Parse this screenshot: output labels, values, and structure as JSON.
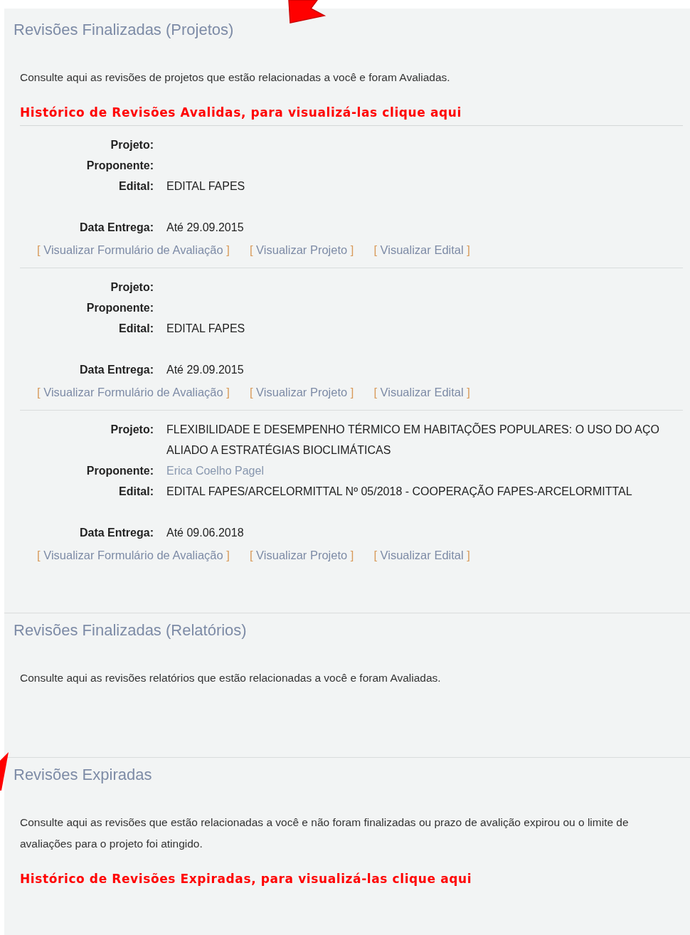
{
  "sections": [
    {
      "title": "Revisões Finalizadas (Projetos)",
      "description": "Consulte aqui as revisões de projetos que estão relacionadas a você e foram Avaliadas.",
      "history_link": "Histórico de Revisões Avalidas, para visualizá-las clique aqui",
      "records": [
        {
          "fields": [
            {
              "label": "Projeto:"
            },
            {
              "label": "Proponente:"
            },
            {
              "label": "Edital:",
              "value": "EDITAL FAPES"
            },
            {
              "label": "Data Entrega:",
              "value": "Até 29.09.2015"
            }
          ],
          "links": [
            {
              "open": "[",
              "label": "Visualizar Formulário de Avaliação",
              "close": "]"
            },
            {
              "open": "[",
              "label": "Visualizar Projeto",
              "close": "]"
            },
            {
              "open": "[",
              "label": "Visualizar Edital",
              "close": "]"
            }
          ]
        },
        {
          "fields": [
            {
              "label": "Projeto:"
            },
            {
              "label": "Proponente:"
            },
            {
              "label": "Edital:",
              "value": "EDITAL FAPES"
            },
            {
              "label": "Data Entrega:",
              "value": "Até 29.09.2015"
            }
          ],
          "links": [
            {
              "open": "[",
              "label": "Visualizar Formulário de Avaliação",
              "close": "]"
            },
            {
              "open": "[",
              "label": "Visualizar Projeto",
              "close": "]"
            },
            {
              "open": "[",
              "label": "Visualizar Edital",
              "close": "]"
            }
          ]
        },
        {
          "fields": [
            {
              "label": "Projeto:",
              "value": "FLEXIBILIDADE E DESEMPENHO TÉRMICO EM HABITAÇÕES POPULARES: O USO DO AÇO ALIADO A ESTRATÉGIAS BIOCLIMÁTICAS"
            },
            {
              "label": "Proponente:",
              "value": "Erica Coelho Pagel",
              "kind": "person"
            },
            {
              "label": "Edital:",
              "value": "EDITAL FAPES/ARCELORMITTAL Nº 05/2018 - COOPERAÇÃO FAPES-ARCELORMITTAL"
            },
            {
              "label": "Data Entrega:",
              "value": "Até 09.06.2018"
            }
          ],
          "links": [
            {
              "open": "[",
              "label": "Visualizar Formulário de Avaliação",
              "close": "]"
            },
            {
              "open": "[",
              "label": "Visualizar Projeto",
              "close": "]"
            },
            {
              "open": "[",
              "label": "Visualizar Edital",
              "close": "]"
            }
          ]
        }
      ]
    },
    {
      "title": "Revisões Finalizadas (Relatórios)",
      "description": "Consulte aqui as revisões relatórios que estão relacionadas a você e foram Avaliadas."
    },
    {
      "title": "Revisões Expiradas",
      "description": "Consulte aqui as revisões que estão relacionadas a você e não foram finalizadas ou prazo de avalição expirou ou o limite de avaliações para o projeto foi atingido.",
      "history_link": "Histórico de Revisões Expiradas, para visualizá-las clique aqui"
    }
  ]
}
